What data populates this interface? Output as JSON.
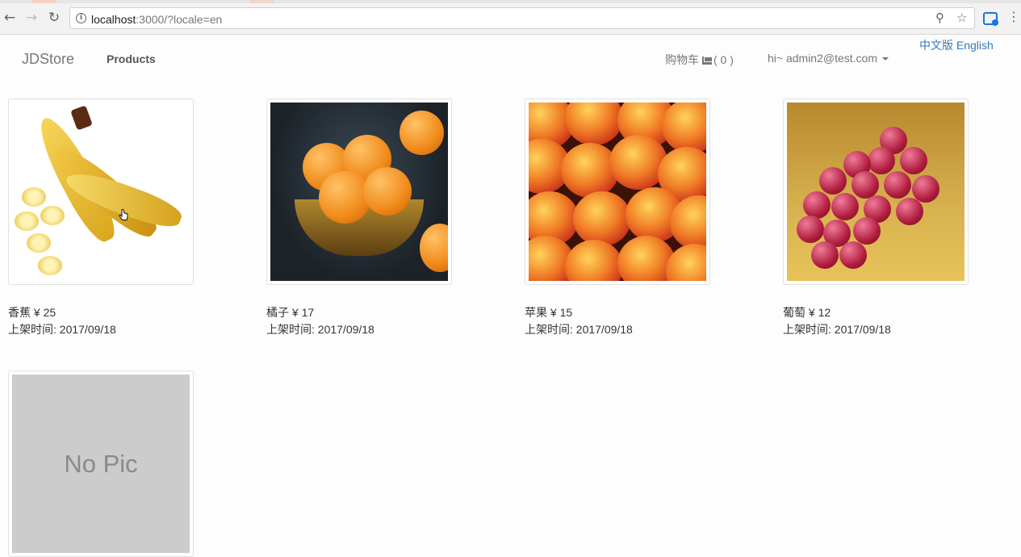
{
  "browser": {
    "url_host": "localhost",
    "url_rest": ":3000/?locale=en"
  },
  "navbar": {
    "brand": "JDStore",
    "products": "Products",
    "cart_label": "购物车",
    "cart_count": "( 0 )",
    "user": "hi~ admin2@test.com",
    "locale_zh": "中文版",
    "locale_en": "English"
  },
  "products": [
    {
      "name": "香蕉",
      "price": "¥ 25",
      "date_label": "上架时间: 2017/09/18",
      "image": "banana"
    },
    {
      "name": "橘子",
      "price": "¥ 17",
      "date_label": "上架时间: 2017/09/18",
      "image": "orange"
    },
    {
      "name": "苹果",
      "price": "¥ 15",
      "date_label": "上架时间: 2017/09/18",
      "image": "apple"
    },
    {
      "name": "葡萄",
      "price": "¥ 12",
      "date_label": "上架时间: 2017/09/18",
      "image": "grape"
    },
    {
      "name": "",
      "price": "",
      "date_label": "",
      "image": "none",
      "placeholder": "No Pic"
    }
  ]
}
